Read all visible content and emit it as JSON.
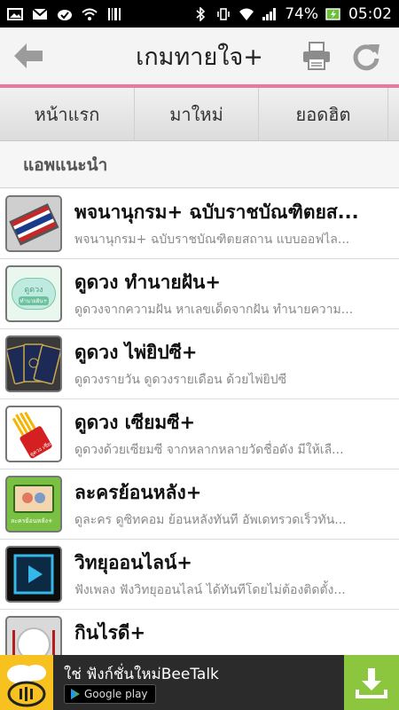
{
  "status": {
    "battery": "74%",
    "time": "05:02"
  },
  "header": {
    "title": "เกมทายใจ+"
  },
  "tabs": [
    "หน้าแรก",
    "มาใหม่",
    "ยอดฮิต"
  ],
  "section": {
    "title": "แอพแนะนำ"
  },
  "items": [
    {
      "name": "พจนานุกรม+ ฉบับราชบัณฑิตยส...",
      "desc": "พจนานุกรม+ ฉบับราชบัณฑิตยสถาน แบบออฟไล..."
    },
    {
      "name": "ดูดวง ทำนายฝัน+",
      "desc": "ดูดวงจากความฝัน หาเลขเด็ดจากฝัน ทำนายความ..."
    },
    {
      "name": "ดูดวง ไพ่ยิปซี+",
      "desc": "ดูดวงรายวัน ดูดวงรายเดือน ด้วยไพ่ยิปซี"
    },
    {
      "name": "ดูดวง เซียมซี+",
      "desc": "ดูดวงด้วยเซียมซี จากหลากหลายวัดชื่อดัง มีให้เลื..."
    },
    {
      "name": "ละครย้อนหลัง+",
      "desc": "ดูละคร ดูซิทคอม ย้อนหลังทันที อัพเดทรวดเร็วทัน..."
    },
    {
      "name": "วิทยุออนไลน์+",
      "desc": "ฟังเพลง ฟังวิทยุออนไลน์ ได้ทันทีโดยไม่ต้องติดตั้ง..."
    },
    {
      "name": "กินไรดี+",
      "desc": ""
    }
  ],
  "thumb_labels": {
    "dream": "ดูดวง",
    "dream_sub": "ทำนายฝัน+",
    "siamsi": "ดูดวง เซียมซี",
    "lakorn": "ละครย้อนหลัง+"
  },
  "ad": {
    "text": "ใช่ ฟังก์ชั่นใหม่BeeTalk",
    "store": "Google play"
  },
  "colors": {
    "accent": "#e9799f",
    "ad_download": "#8cc63e",
    "ad_brand": "#f7c21f"
  }
}
